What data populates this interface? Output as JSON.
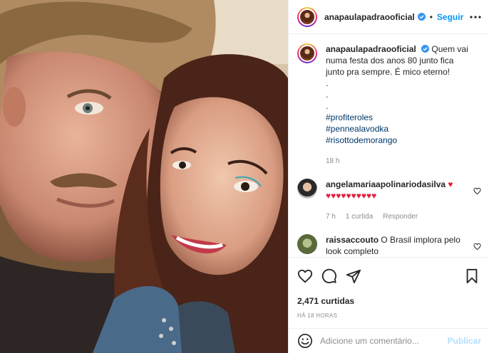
{
  "post": {
    "author": "anapaulapadraooficial",
    "follow_label": "Seguir",
    "separator": "•",
    "caption_lines": [
      "Quem vai numa festa dos anos 80 junto fica junto pra sempre. É mico eterno!",
      ".",
      ".",
      "."
    ],
    "hashtags": [
      "#profiteroles",
      "#pennealavodka",
      "#risottodemorango"
    ],
    "caption_age": "18 h"
  },
  "comments": [
    {
      "username": "angelamariaapolinariodasilva",
      "text": "♥ ♥♥♥♥♥♥♥♥♥♥",
      "age": "7 h",
      "likes": "1 curtida",
      "reply_label": "Responder"
    },
    {
      "username": "raissaccouto",
      "text": "O Brasil implora pelo look completo"
    }
  ],
  "engagement": {
    "likes_text": "2,471 curtidas",
    "posted_ago": "HÁ 18 HORAS"
  },
  "composer": {
    "placeholder": "Adicione um comentário...",
    "publish_label": "Publicar"
  },
  "colors": {
    "accent": "#0095f6",
    "hashtag": "#00376b",
    "muted": "#8e8e8e",
    "heart": "#e01f3d"
  },
  "icons": [
    "more-options-icon",
    "verified-icon",
    "like-icon",
    "comment-icon",
    "share-icon",
    "save-icon",
    "emoji-icon",
    "small-heart-icon"
  ]
}
